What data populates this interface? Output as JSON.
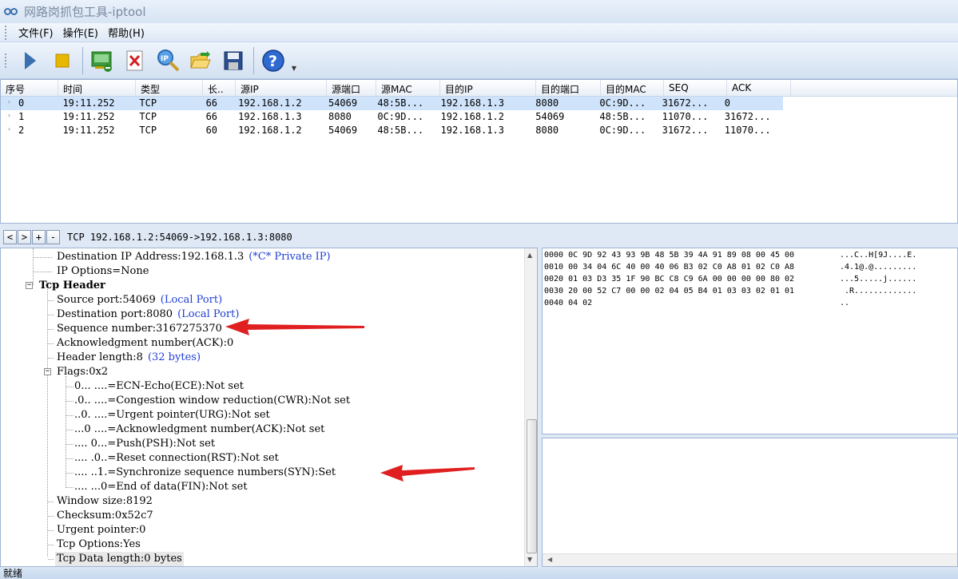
{
  "title": "网路岗抓包工具-iptool",
  "menu": [
    {
      "label": "文件(F)"
    },
    {
      "label": "操作(E)"
    },
    {
      "label": "帮助(H)"
    }
  ],
  "toolbar": {
    "buttons": [
      "play-icon",
      "stop-icon",
      "network-card-icon",
      "delete-icon",
      "ip-search-icon",
      "open-folder-icon",
      "save-icon",
      "help-icon"
    ]
  },
  "packet_list": {
    "columns": [
      "序号",
      "时间",
      "类型",
      "长..",
      "源IP",
      "源端口",
      "源MAC",
      "目的IP",
      "目的端口",
      "目的MAC",
      "SEQ",
      "ACK"
    ],
    "rows": [
      [
        "0",
        "19:11.252",
        "TCP",
        "66",
        "192.168.1.2",
        "54069",
        "48:5B...",
        "192.168.1.3",
        "8080",
        "0C:9D...",
        "31672...",
        "0"
      ],
      [
        "1",
        "19:11.252",
        "TCP",
        "66",
        "192.168.1.3",
        "8080",
        "0C:9D...",
        "192.168.1.2",
        "54069",
        "48:5B...",
        "11070...",
        "31672..."
      ],
      [
        "2",
        "19:11.252",
        "TCP",
        "60",
        "192.168.1.2",
        "54069",
        "48:5B...",
        "192.168.1.3",
        "8080",
        "0C:9D...",
        "31672...",
        "11070..."
      ]
    ],
    "selected_row": 0
  },
  "nav": {
    "buttons": [
      "<",
      ">",
      "+",
      "-"
    ],
    "summary": "TCP 192.168.1.2:54069->192.168.1.3:8080"
  },
  "tree": {
    "dst_ip": "Destination IP Address:192.168.1.3",
    "dst_ip_note": "(*C* Private IP)",
    "ip_options": "IP Options=None",
    "tcp_header": "Tcp Header",
    "src_port": "Source port:54069",
    "src_port_note": "(Local Port)",
    "dst_port": "Destination port:8080",
    "dst_port_note": "(Local Port)",
    "seq": "Sequence number:3167275370",
    "ack": "Acknowledgment number(ACK):0",
    "header_len": "Header length:8",
    "header_len_note": "(32 bytes)",
    "flags": "Flags:0x2",
    "flag_items": [
      "0... ....=ECN-Echo(ECE):Not set",
      ".0.. ....=Congestion window reduction(CWR):Not set",
      "..0. ....=Urgent pointer(URG):Not set",
      "...0 ....=Acknowledgment number(ACK):Not set",
      ".... 0...=Push(PSH):Not set",
      ".... .0..=Reset connection(RST):Not set",
      ".... ..1.=Synchronize sequence numbers(SYN):Set",
      ".... ...0=End of data(FIN):Not set"
    ],
    "window": "Window size:8192",
    "checksum": "Checksum:0x52c7",
    "urgent": "Urgent pointer:0",
    "options": "Tcp Options:Yes",
    "data_len": "Tcp Data length:0 bytes"
  },
  "hex": {
    "lines": [
      "0000 0C 9D 92 43 93 9B 48 5B 39 4A 91 89 08 00 45 00",
      "0010 00 34 04 6C 40 00 40 06 B3 02 C0 A8 01 02 C0 A8",
      "0020 01 03 D3 35 1F 90 BC C8 C9 6A 00 00 00 00 80 02",
      "0030 20 00 52 C7 00 00 02 04 05 B4 01 03 03 02 01 01",
      "0040 04 02"
    ],
    "ascii": [
      "...C..H[9J....E.",
      ".4.1@.@.........",
      "...5.....j......",
      " .R.............",
      ".."
    ]
  },
  "status": "就绪",
  "colors": {
    "annotation_arrow": "#e02020",
    "note_blue": "#1f3fd6",
    "selected_row": "#cfe3fb"
  }
}
